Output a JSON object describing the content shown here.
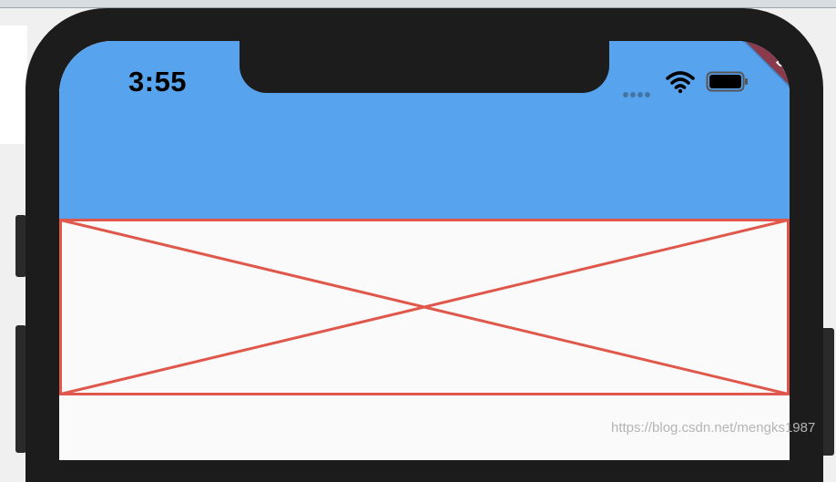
{
  "status_bar": {
    "time": "3:55"
  },
  "debug_banner": {
    "label": "DEBUG"
  },
  "colors": {
    "appbar": "#58a3ee",
    "placeholder_stroke": "#e0574b",
    "phone_frame": "#1c1c1c",
    "debug_banner": "#8b3a4b"
  },
  "icons": {
    "signal": "signal-dots-icon",
    "wifi": "wifi-icon",
    "battery": "battery-icon"
  },
  "watermark": {
    "text": "https://blog.csdn.net/mengks1987"
  }
}
